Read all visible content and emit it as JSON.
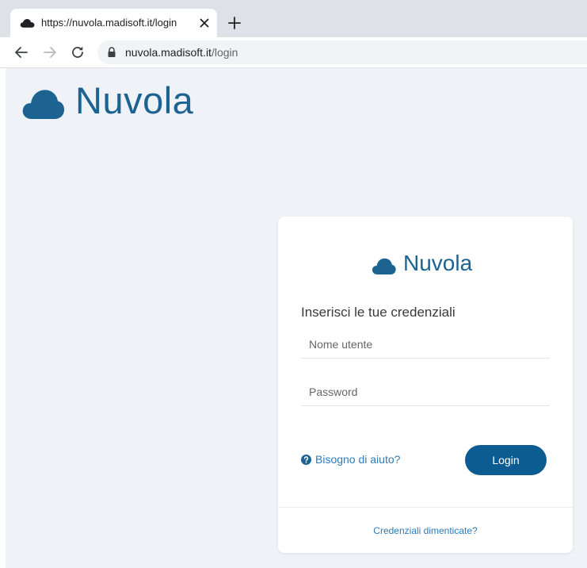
{
  "browser": {
    "tab": {
      "title": "https://nuvola.madisoft.it/login",
      "favicon": "cloud-icon"
    },
    "new_tab_icon": "plus-icon",
    "close_icon": "close-icon",
    "nav": {
      "back_icon": "arrow-left-icon",
      "forward_icon": "arrow-right-icon",
      "reload_icon": "reload-icon"
    },
    "omnibox": {
      "host": "nuvola.madisoft.it",
      "path": "/login",
      "lock_icon": "lock-icon"
    }
  },
  "page": {
    "brand": {
      "name": "Nuvola",
      "icon": "cloud-icon"
    },
    "card": {
      "logo_text": "Nuvola",
      "heading": "Inserisci le tue credenziali",
      "username": {
        "value": "",
        "placeholder": "Nome utente"
      },
      "password": {
        "value": "",
        "placeholder": "Password"
      },
      "help_link": "Bisogno di aiuto?",
      "help_icon": "question-circle-icon",
      "login_button": "Login",
      "forgot_link": "Credenziali dimenticate?"
    }
  },
  "colors": {
    "brand": "#1c6392",
    "button": "#0d5c91",
    "link": "#2f7ab9",
    "page_background": "#eff3f8"
  }
}
